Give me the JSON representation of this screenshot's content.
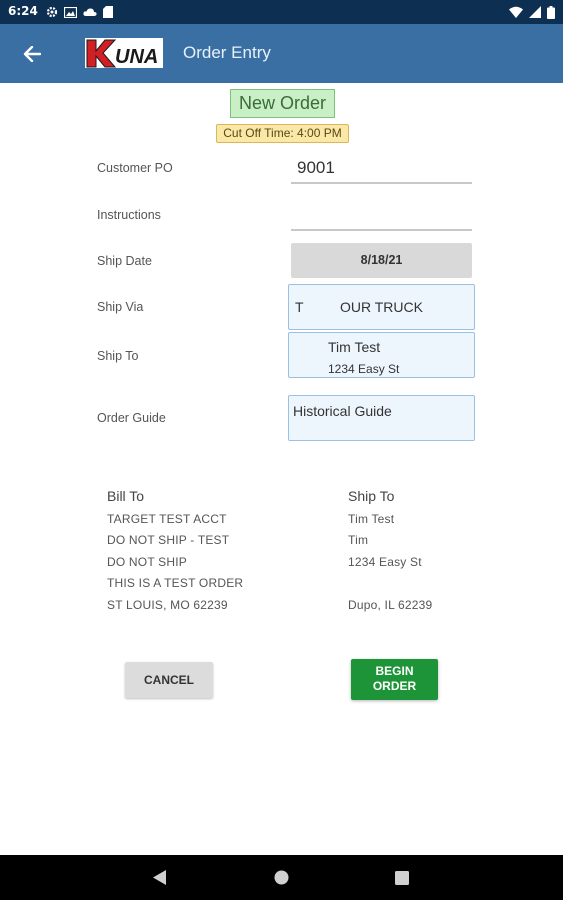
{
  "status_bar": {
    "time": "6:24",
    "left_icons": [
      "gear-icon",
      "image-icon",
      "cloud-icon",
      "sd-card-icon"
    ],
    "right_icons": [
      "wifi-icon",
      "signal-icon",
      "battery-icon"
    ]
  },
  "app_bar": {
    "logo_text": "KUNA",
    "title": "Order Entry",
    "bg_color": "#3a6fa3"
  },
  "header": {
    "new_order_label": "New Order",
    "cutoff_label": "Cut Off Time: 4:00 PM"
  },
  "form": {
    "customer_po_label": "Customer PO",
    "customer_po_value": "9001",
    "instructions_label": "Instructions",
    "instructions_value": "",
    "ship_date_label": "Ship Date",
    "ship_date_value": "8/18/21",
    "ship_via_label": "Ship Via",
    "ship_via_code": "T",
    "ship_via_value": "OUR TRUCK",
    "ship_to_label": "Ship To",
    "ship_to_name": "Tim Test",
    "ship_to_address": "1234 Easy St",
    "order_guide_label": "Order Guide",
    "order_guide_value": "Historical Guide"
  },
  "addresses": {
    "bill_to": {
      "heading": "Bill To",
      "lines": [
        "TARGET TEST ACCT",
        "DO NOT SHIP - TEST",
        "DO NOT SHIP",
        "THIS IS A TEST ORDER",
        "ST LOUIS, MO 62239"
      ]
    },
    "ship_to": {
      "heading": "Ship To",
      "lines": [
        "Tim Test",
        "Tim",
        "1234 Easy St",
        "",
        "Dupo, IL 62239"
      ]
    }
  },
  "actions": {
    "cancel_label": "CANCEL",
    "begin_label_line1": "BEGIN",
    "begin_label_line2": "ORDER",
    "begin_color": "#1e9438"
  },
  "nav": {
    "icons": [
      "back-triangle-icon",
      "home-circle-icon",
      "recents-square-icon"
    ]
  }
}
